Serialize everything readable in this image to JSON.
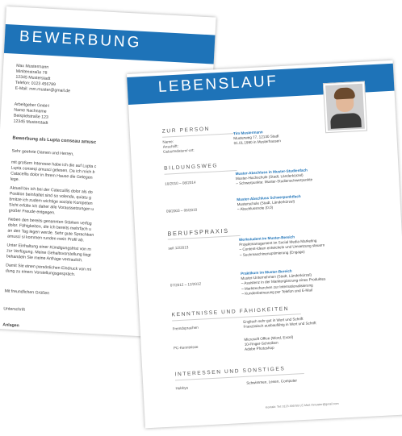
{
  "bewerbung": {
    "title": "BEWERBUNG",
    "sender": [
      "Max Mustermann",
      "Minitenstraße 78",
      "12345 Musterstadt",
      "Telefon: 0123 456789",
      "E-Mail: mm.muster@gmail.de"
    ],
    "recipient": [
      "Arbeitgeber GmbH",
      "Name Nachname",
      "Beispielstraße 123",
      "12345 Musterstadt"
    ],
    "subject": "Bewerbung als Lupta conseau amusc",
    "salutation": "Sehr geehrte Damen und Herren,",
    "body": [
      "mit großem Interesse habe ich die auf Lupta c",
      "Lupta conseqi amusci gelesen. Da ich mich b",
      "Catacellis dolor in Ihrem Hause die Gelegen",
      "lege.",
      "Aktuell bin ich bei der Catecuillis dolor als do",
      "Position beinhaltet sind so volenda, quiatu g",
      "bmitze ich zudem wichtige soziale Kompeten",
      "Sicht erfülle ich daher alle Voraussetzungen u",
      "großer Freude entgegen.",
      "Neben den bereits genannten Stärken verfüg",
      "dolor. Fähigkeiten, die ich bereits mehrfach u",
      "an den Tag legen werde. Sehr gute Sprachken",
      "amusci si kommen runden mein Profil ab.",
      "Unter Einhaltung einer Kündigungsfrist von m",
      "zur Verfügung. Meine Gehaltsvorstellung liegt",
      "behandeln Sie meine Anfrage vertraulich.",
      "Damit Sie einen persönlichen Eindruck von mi",
      "dung zu einem Vorstellungsgespräch."
    ],
    "closing": "Mit freundlichen Grüßen",
    "signature": "Unterschrift",
    "attachments": "Anlagen"
  },
  "lebenslauf": {
    "title": "LEBENSLAUF",
    "person": {
      "heading": "ZUR PERSON",
      "labels": [
        "Name:",
        "Anschrift:",
        "Geburtsdatum/-ort:"
      ],
      "name": "Tim Mustermann",
      "address": "Musterweg 77, 12130 Stadt",
      "birth": "01.01.1990 in Musterhausen"
    },
    "education": {
      "heading": "BILDUNGSWEG",
      "entries": [
        {
          "date": "10/2010 – 08/2014",
          "title": "Muster-Abschluss in Muster-Studienfach",
          "place": "Muster-Hochschule (Stadt, Länderkürzel)",
          "detail": "Schwerpunkte: Muster-Studienschwerpunkte"
        },
        {
          "date": "09/2003 – 06/2010",
          "title": "Muster-Abschluss Schwerpunktfach",
          "place": "Musterschule (Stadt, Länderkürzel)",
          "detail": "Abschlussnote (0,0)"
        }
      ]
    },
    "experience": {
      "heading": "BERUFSPRAXIS",
      "entries": [
        {
          "date": "seit 12/2013",
          "title": "Werkstudent im Muster-Bereich",
          "place": "Projektmanagement im Social Media Marketing",
          "details": [
            "Content-Ideen entwickeln und Umsetzung steuern",
            "Suchmaschinenoptimierung (Engage)"
          ]
        },
        {
          "date": "07/2012 – 12/2012",
          "title": "Praktikum im Muster-Bereich",
          "place": "Muster-Unternehmen (Stadt, Länderkürzel)",
          "details": [
            "Assistenz in der Marktergänzung eines Produktes",
            "Marktrecherchen zur Internationalisierung",
            "Kundenbetreuung per Telefon und E-Mail"
          ]
        }
      ]
    },
    "skills": {
      "heading": "KENNTNISSE UND FÄHIGKEITEN",
      "rows": [
        {
          "label": "Fremdsprachen",
          "values": [
            "Englisch sehr gut in Wort und Schrift",
            "Französisch ausbaufähig in Wort und Schrift"
          ]
        },
        {
          "label": "PC-Kenntnisse",
          "values": [
            "Microsoft Office (Word, Excel)",
            "10-Finger-Schreiben",
            "Adobe Photoshop"
          ]
        }
      ]
    },
    "interests": {
      "heading": "INTERESSEN UND SONSTIGES",
      "label": "Hobbys",
      "value": "Schwimmen, Lesen, Computer"
    },
    "footer": "Kontakt: Tel: 0123 456789 | E-Mail: thmuster@gmail.com"
  }
}
